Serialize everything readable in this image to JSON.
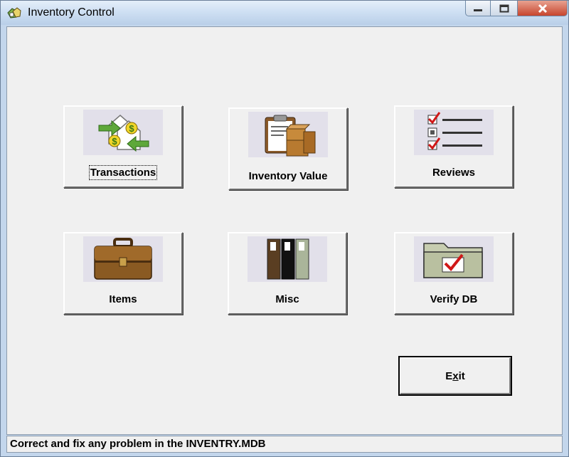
{
  "window": {
    "title": "Inventory Control",
    "controls": [
      "minimize-icon",
      "maximize-icon",
      "close-icon"
    ]
  },
  "tiles": [
    {
      "label": "Transactions",
      "icon": "transactions-icon",
      "focused": true
    },
    {
      "label": "Inventory Value",
      "icon": "inventory-value-icon"
    },
    {
      "label": "Reviews",
      "icon": "reviews-checklist-icon"
    },
    {
      "label": "Items",
      "icon": "briefcase-icon"
    },
    {
      "label": "Misc",
      "icon": "binders-icon"
    },
    {
      "label": "Verify DB",
      "icon": "verify-folder-icon"
    }
  ],
  "exit": {
    "label_pre": "E",
    "label_mnemonic": "x",
    "label_post": "it"
  },
  "status": {
    "text": "Correct and fix any problem in the INVENTRY.MDB"
  },
  "colors": {
    "titlebar": "#cfe0f3",
    "close": "#c7452d",
    "face": "#f0f0f0"
  }
}
